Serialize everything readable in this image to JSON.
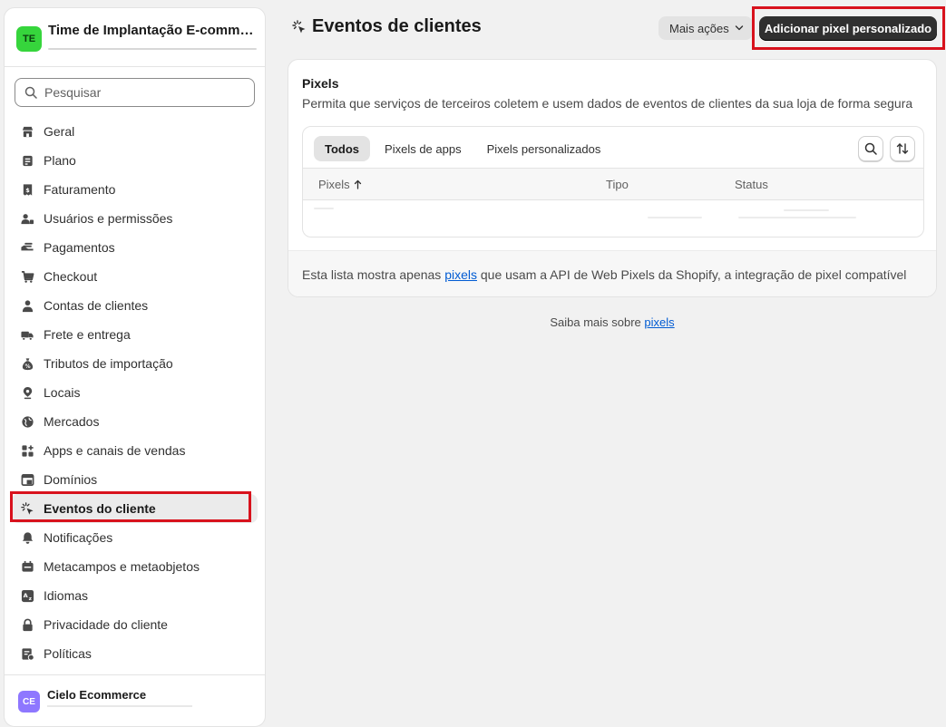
{
  "sidebar": {
    "store": {
      "initials": "TE",
      "name": "Time de Implantação E-comme..."
    },
    "search": {
      "placeholder": "Pesquisar"
    },
    "items": [
      {
        "label": "Geral",
        "icon": "store-icon"
      },
      {
        "label": "Plano",
        "icon": "plan-icon"
      },
      {
        "label": "Faturamento",
        "icon": "billing-icon"
      },
      {
        "label": "Usuários e permissões",
        "icon": "users-icon"
      },
      {
        "label": "Pagamentos",
        "icon": "payments-icon"
      },
      {
        "label": "Checkout",
        "icon": "cart-icon"
      },
      {
        "label": "Contas de clientes",
        "icon": "person-icon"
      },
      {
        "label": "Frete e entrega",
        "icon": "truck-icon"
      },
      {
        "label": "Tributos de importação",
        "icon": "money-bag-icon"
      },
      {
        "label": "Locais",
        "icon": "location-icon"
      },
      {
        "label": "Mercados",
        "icon": "globe-icon"
      },
      {
        "label": "Apps e canais de vendas",
        "icon": "apps-icon"
      },
      {
        "label": "Domínios",
        "icon": "domain-icon"
      },
      {
        "label": "Eventos do cliente",
        "icon": "cursor-click-icon",
        "active": true
      },
      {
        "label": "Notificações",
        "icon": "bell-icon"
      },
      {
        "label": "Metacampos e metaobjetos",
        "icon": "metafields-icon"
      },
      {
        "label": "Idiomas",
        "icon": "language-icon"
      },
      {
        "label": "Privacidade do cliente",
        "icon": "lock-icon"
      },
      {
        "label": "Políticas",
        "icon": "policies-icon"
      }
    ],
    "footer": {
      "initials": "CE",
      "name": "Cielo Ecommerce"
    }
  },
  "header": {
    "title": "Eventos de clientes",
    "more_actions": "Mais ações",
    "add_pixel": "Adicionar pixel personalizado"
  },
  "card": {
    "title": "Pixels",
    "description": "Permita que serviços de terceiros coletem e usem dados de eventos de clientes da sua loja de forma segura",
    "tabs": [
      "Todos",
      "Pixels de apps",
      "Pixels personalizados"
    ],
    "columns": [
      "Pixels",
      "Tipo",
      "Status"
    ],
    "footer_before": "Esta lista mostra apenas ",
    "footer_link": "pixels",
    "footer_after": " que usam a API de Web Pixels da Shopify, a integração de pixel compatível"
  },
  "learn_more": {
    "text": "Saiba mais sobre ",
    "link": "pixels"
  },
  "colors": {
    "highlight": "#d8121d",
    "store_avatar": "#36d53c",
    "footer_avatar": "#8e77ff",
    "primary_button": "#303030",
    "link": "#005bd3"
  }
}
